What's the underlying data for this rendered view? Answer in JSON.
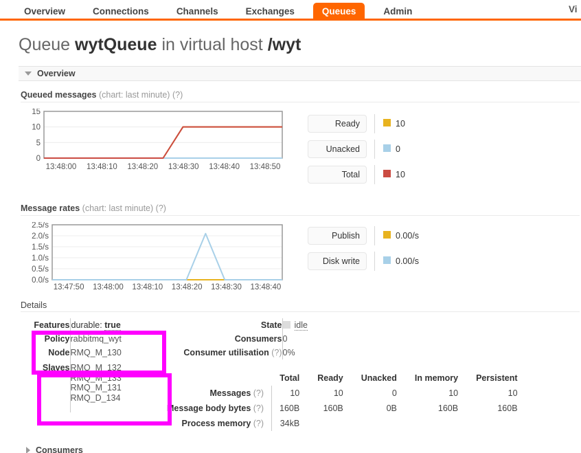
{
  "nav": {
    "tabs": [
      {
        "label": "Overview",
        "active": false
      },
      {
        "label": "Connections",
        "active": false
      },
      {
        "label": "Channels",
        "active": false
      },
      {
        "label": "Exchanges",
        "active": false
      },
      {
        "label": "Queues",
        "active": true
      },
      {
        "label": "Admin",
        "active": false
      }
    ],
    "right_label": "Vi"
  },
  "page": {
    "title_prefix": "Queue ",
    "title_queue": "wytQueue",
    "title_middle": " in virtual host ",
    "title_vhost": "/wyt"
  },
  "overview_section": {
    "label": "Overview"
  },
  "consumers_section": {
    "label": "Consumers"
  },
  "details_section": {
    "label": "Details"
  },
  "charts": {
    "queued": {
      "caption": "Queued messages",
      "caption_sub": "(chart: last minute)",
      "help": "(?)",
      "legend": [
        {
          "name": "Ready",
          "value": "10",
          "color": "#e8b31f"
        },
        {
          "name": "Unacked",
          "value": "0",
          "color": "#a8d0e8"
        },
        {
          "name": "Total",
          "value": "10",
          "color": "#cb4b42"
        }
      ]
    },
    "rates": {
      "caption": "Message rates",
      "caption_sub": "(chart: last minute)",
      "help": "(?)",
      "legend": [
        {
          "name": "Publish",
          "value": "0.00/s",
          "color": "#e8b31f"
        },
        {
          "name": "Disk write",
          "value": "0.00/s",
          "color": "#a8d0e8"
        }
      ]
    }
  },
  "chart_data": [
    {
      "type": "line",
      "title": "Queued messages",
      "subtitle": "chart: last minute",
      "xlabel": "",
      "ylabel": "",
      "ylim": [
        0,
        15
      ],
      "yticks": [
        0,
        5,
        10,
        15
      ],
      "ytick_labels": [
        "0",
        "5",
        "10",
        "15"
      ],
      "xtick_labels": [
        "13:48:00",
        "13:48:10",
        "13:48:20",
        "13:48:30",
        "13:48:40",
        "13:48:50"
      ],
      "grid": true,
      "legend_position": "right",
      "x": [
        "13:47:55",
        "13:48:00",
        "13:48:05",
        "13:48:10",
        "13:48:15",
        "13:48:20",
        "13:48:25",
        "13:48:30",
        "13:48:35",
        "13:48:40",
        "13:48:45",
        "13:48:50",
        "13:48:55"
      ],
      "series": [
        {
          "name": "Total",
          "color": "#cb4b42",
          "values": [
            0,
            0,
            0,
            0,
            0,
            0,
            0,
            10,
            10,
            10,
            10,
            10,
            10
          ]
        },
        {
          "name": "Unacked",
          "color": "#a8d0e8",
          "values": [
            0,
            0,
            0,
            0,
            0,
            0,
            0,
            0,
            0,
            0,
            0,
            0,
            0
          ]
        },
        {
          "name": "Ready",
          "color": "#e8b31f",
          "values": [
            0,
            0,
            0,
            0,
            0,
            0,
            0,
            10,
            10,
            10,
            10,
            10,
            10
          ]
        }
      ]
    },
    {
      "type": "line",
      "title": "Message rates",
      "subtitle": "chart: last minute",
      "xlabel": "",
      "ylabel": "",
      "ylim": [
        0,
        2.5
      ],
      "yticks": [
        0.0,
        0.5,
        1.0,
        1.5,
        2.0,
        2.5
      ],
      "ytick_labels": [
        "0.0/s",
        "0.5/s",
        "1.0/s",
        "1.5/s",
        "2.0/s",
        "2.5/s"
      ],
      "xtick_labels": [
        "13:47:50",
        "13:48:00",
        "13:48:10",
        "13:48:20",
        "13:48:30",
        "13:48:40"
      ],
      "grid": true,
      "legend_position": "right",
      "x": [
        "13:47:45",
        "13:47:50",
        "13:47:55",
        "13:48:00",
        "13:48:05",
        "13:48:10",
        "13:48:15",
        "13:48:20",
        "13:48:25",
        "13:48:30",
        "13:48:35",
        "13:48:40",
        "13:48:45"
      ],
      "series": [
        {
          "name": "Disk write",
          "color": "#a8d0e8",
          "values": [
            0,
            0,
            0,
            0,
            0,
            0,
            0,
            0,
            2.1,
            0,
            0,
            0,
            0
          ]
        },
        {
          "name": "Publish",
          "color": "#e8b31f",
          "values": [
            0,
            0,
            0,
            0,
            0,
            0,
            0,
            0,
            0,
            0,
            0,
            0,
            0
          ]
        }
      ]
    }
  ],
  "details": {
    "features_label": "Features",
    "features_key": "durable:",
    "features_value": "true",
    "policy_label": "Policy",
    "policy_value": "rabbitmq_wyt",
    "node_label": "Node",
    "node_value": "RMQ_M_130",
    "slaves_label": "Slaves",
    "slaves_values": [
      "RMQ_M_132",
      "RMQ_M_133",
      "RMQ_M_131",
      "RMQ_D_134"
    ],
    "state_label": "State",
    "state_value": "idle",
    "consumers_label": "Consumers",
    "consumers_value": "0",
    "consumer_util_label": "Consumer utilisation",
    "consumer_util_help": "(?)",
    "consumer_util_value": "0%"
  },
  "stats": {
    "columns": [
      "Total",
      "Ready",
      "Unacked",
      "In memory",
      "Persistent"
    ],
    "rows": [
      {
        "label": "Messages",
        "help": "(?)",
        "values": [
          "10",
          "10",
          "0",
          "10",
          "10"
        ]
      },
      {
        "label": "Message body bytes",
        "help": "(?)",
        "values": [
          "160B",
          "160B",
          "0B",
          "160B",
          "160B"
        ]
      },
      {
        "label": "Process memory",
        "help": "(?)",
        "values": [
          "34kB",
          "",
          "",
          "",
          ""
        ]
      }
    ]
  },
  "highlight_color": "#ff00ff"
}
